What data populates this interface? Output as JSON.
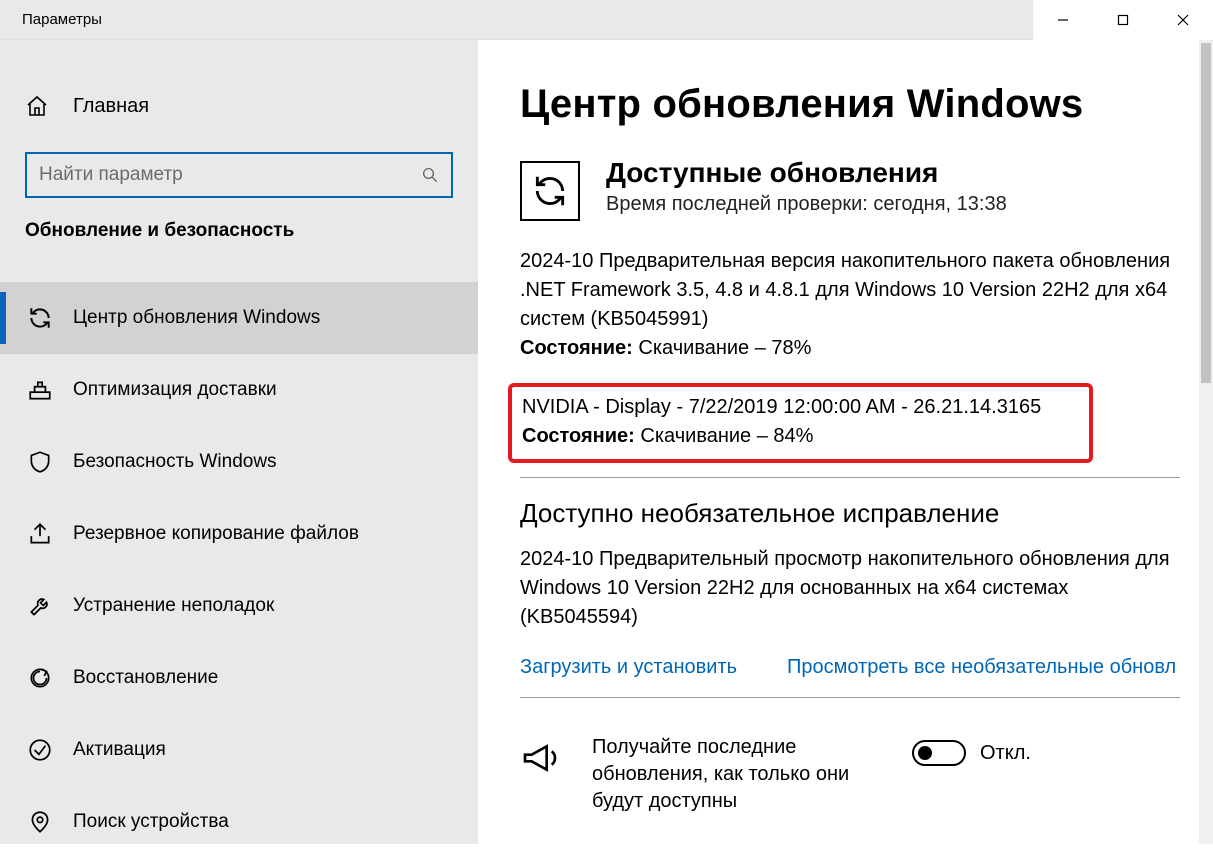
{
  "window": {
    "title": "Параметры"
  },
  "sidebar": {
    "home_label": "Главная",
    "search_placeholder": "Найти параметр",
    "section_label": "Обновление и безопасность",
    "items": [
      {
        "label": "Центр обновления Windows"
      },
      {
        "label": "Оптимизация доставки"
      },
      {
        "label": "Безопасность Windows"
      },
      {
        "label": "Резервное копирование файлов"
      },
      {
        "label": "Устранение неполадок"
      },
      {
        "label": "Восстановление"
      },
      {
        "label": "Активация"
      },
      {
        "label": "Поиск устройства"
      }
    ]
  },
  "main": {
    "page_title": "Центр обновления Windows",
    "status_title": "Доступные обновления",
    "status_subtitle": "Время последней проверки: сегодня, 13:38",
    "updates": [
      {
        "title": "2024-10 Предварительная версия накопительного пакета обновления .NET Framework 3.5, 4.8 и 4.8.1 для Windows 10 Version 22H2 для x64 систем (KB5045991)",
        "state_label": "Состояние:",
        "state_value": "Скачивание – 78%"
      },
      {
        "title": "NVIDIA - Display - 7/22/2019 12:00:00 AM - 26.21.14.3165",
        "state_label": "Состояние:",
        "state_value": "Скачивание – 84%"
      }
    ],
    "optional_title": "Доступно необязательное исправление",
    "optional_desc": "2024-10 Предварительный просмотр накопительного обновления для Windows 10 Version 22H2 для основанных на x64 системах (KB5045594)",
    "link_download": "Загрузить и установить",
    "link_viewall": "Просмотреть все необязательные обновл",
    "toggle_text": "Получайте последние обновления, как только они будут доступны",
    "toggle_state": "Откл."
  }
}
